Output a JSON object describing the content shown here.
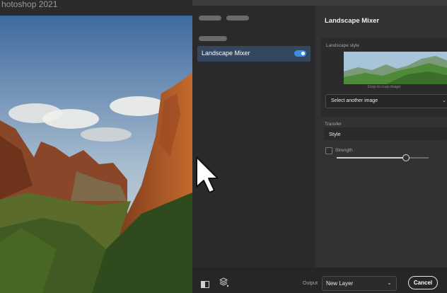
{
  "app": {
    "title": "hotoshop 2021"
  },
  "filter_list": {
    "items": [
      {
        "label": "Landscape Mixer",
        "enabled": true
      }
    ]
  },
  "settings": {
    "title": "Landscape Mixer",
    "landscape_style_label": "Landscape style",
    "thumbnail_caption": "Drop to crop image",
    "select_image_label": "Select another image",
    "transfer_label": "Transfer",
    "transfer_value": "Style",
    "strength_label": "Strength",
    "strength_checked": false,
    "strength_fraction": 0.75
  },
  "footer": {
    "output_label": "Output",
    "output_value": "New Layer",
    "cancel_label": "Cancel"
  },
  "icons": {
    "chevron": "⌄"
  },
  "colors": {
    "accent": "#3b8de6",
    "selected_item": "#34475f",
    "panel": "#323232"
  }
}
